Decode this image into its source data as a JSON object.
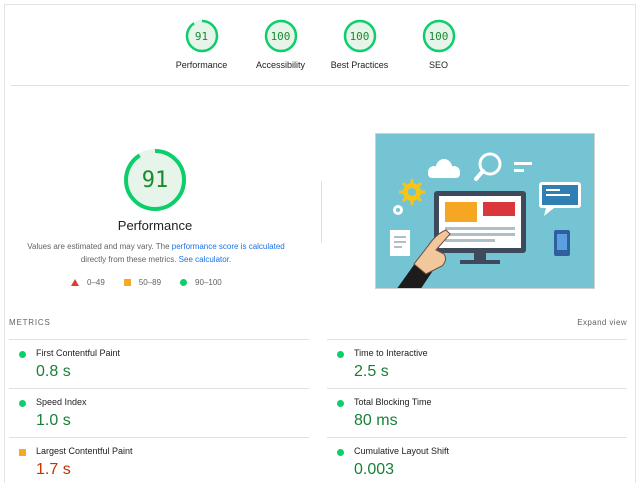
{
  "summary_gauges": [
    {
      "score": "91",
      "label": "Performance",
      "fraction": 0.91
    },
    {
      "score": "100",
      "label": "Accessibility",
      "fraction": 1.0
    },
    {
      "score": "100",
      "label": "Best Practices",
      "fraction": 1.0
    },
    {
      "score": "100",
      "label": "SEO",
      "fraction": 1.0
    }
  ],
  "performance": {
    "score": "91",
    "fraction": 0.91,
    "title": "Performance",
    "note_prefix": "Values are estimated and may vary. The ",
    "note_link1": "performance score is calculated",
    "note_mid": " directly from these metrics. ",
    "note_link2": "See calculator."
  },
  "legend": {
    "fail": "0–49",
    "average": "50–89",
    "pass": "90–100"
  },
  "metrics": {
    "title": "METRICS",
    "expand_label": "Expand view",
    "left": [
      {
        "name": "First Contentful Paint",
        "value": "0.8 s",
        "status": "pass"
      },
      {
        "name": "Speed Index",
        "value": "1.0 s",
        "status": "pass"
      },
      {
        "name": "Largest Contentful Paint",
        "value": "1.7 s",
        "status": "average"
      }
    ],
    "right": [
      {
        "name": "Time to Interactive",
        "value": "2.5 s",
        "status": "pass"
      },
      {
        "name": "Total Blocking Time",
        "value": "80 ms",
        "status": "pass"
      },
      {
        "name": "Cumulative Layout Shift",
        "value": "0.003",
        "status": "pass"
      }
    ]
  },
  "colors": {
    "pass": "#0cce6b",
    "average": "#f9a825",
    "fail": "#e53935",
    "link": "#1a73e8"
  }
}
